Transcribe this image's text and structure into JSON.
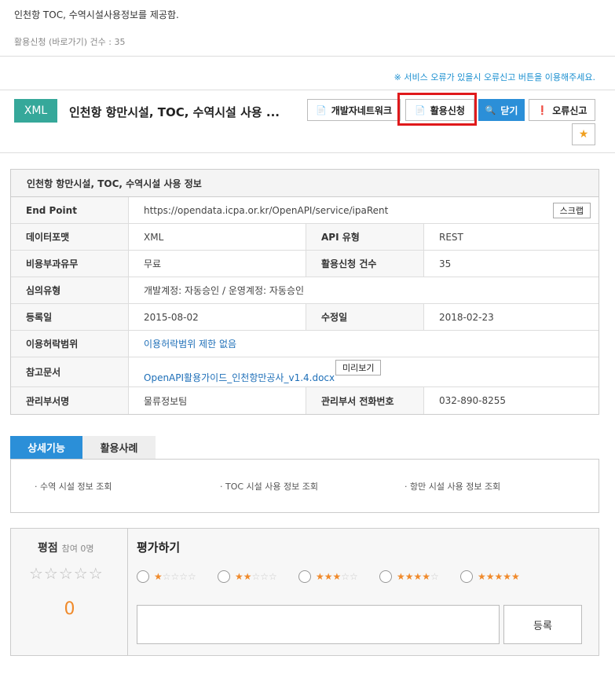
{
  "intro": {
    "text": "인천항 TOC, 수역시설사용정보를 제공함.",
    "usage_count": "활용신청 (바로가기) 건수 : 35"
  },
  "notice": "※ 서비스 오류가 있을시 오류신고 버튼을 이용해주세요.",
  "header": {
    "badge": "XML",
    "title": "인천항 항만시설, TOC, 수역시설 사용 ...",
    "buttons": {
      "dev": "개발자네트워크",
      "apply": "활용신청",
      "close": "닫기",
      "report": "오류신고",
      "star": "★"
    },
    "icons": {
      "doc": "📄",
      "search": "🔍",
      "alert": "❗"
    }
  },
  "info": {
    "heading": "인천항 항만시설, TOC, 수역시설 사용 정보",
    "endpoint_label": "End Point",
    "endpoint_value": "https://opendata.icpa.or.kr/OpenAPI/service/ipaRent",
    "scrap_btn": "스크랩",
    "format_label": "데이터포맷",
    "format_value": "XML",
    "api_type_label": "API 유형",
    "api_type_value": "REST",
    "fee_label": "비용부과유무",
    "fee_value": "무료",
    "apply_count_label": "활용신청 건수",
    "apply_count_value": "35",
    "review_label": "심의유형",
    "review_value": "개발계정: 자동승인 / 운영계정: 자동승인",
    "reg_label": "등록일",
    "reg_value": "2015-08-02",
    "mod_label": "수정일",
    "mod_value": "2018-02-23",
    "license_label": "이용허락범위",
    "license_value": "이용허락범위 제한 없음",
    "doc_label": "참고문서",
    "doc_value": "OpenAPI활용가이드_인천항만공사_v1.4.docx",
    "preview_btn": "미리보기",
    "dept_label": "관리부서명",
    "dept_value": "물류정보팀",
    "phone_label": "관리부서 전화번호",
    "phone_value": "032-890-8255"
  },
  "tabs": {
    "detail": "상세기능",
    "cases": "활용사례"
  },
  "functions": [
    "· 수역 시설 정보 조회",
    "· TOC 시설 사용 정보 조회",
    "· 항만 시설 사용 정보 조회"
  ],
  "rating": {
    "title": "평점",
    "participants": "참여 0명",
    "stars": "☆☆☆☆☆",
    "score": "0",
    "eval_title": "평가하기",
    "submit": "등록"
  },
  "colors": {
    "accent": "#2b8fd8",
    "badge": "#36a89a",
    "highlight": "#e0191b",
    "star": "#f08a2b"
  }
}
